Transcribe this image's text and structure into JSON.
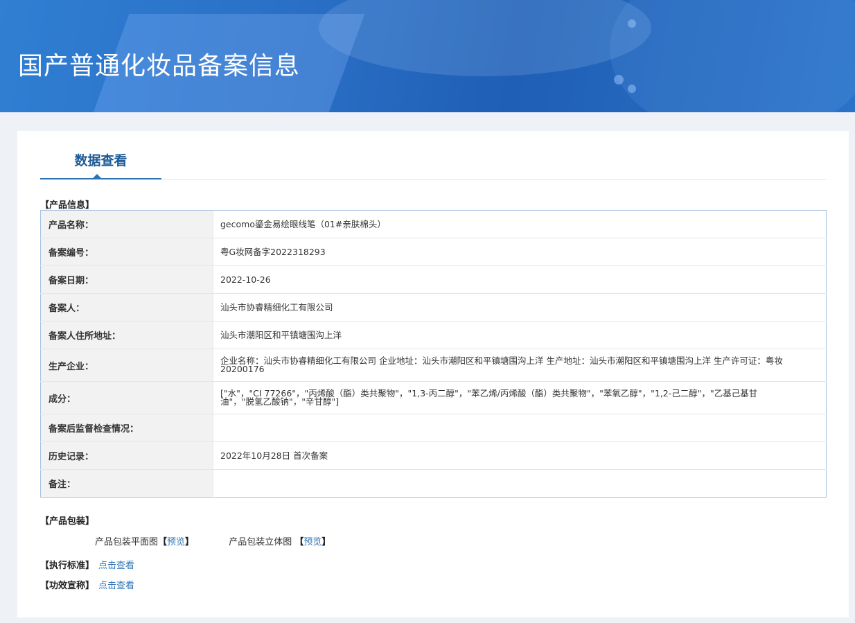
{
  "banner": {
    "title": "国产普通化妆品备案信息"
  },
  "tab": {
    "label": "数据查看"
  },
  "product_info": {
    "heading": "【产品信息】",
    "rows": [
      {
        "label": "产品名称：",
        "value": "gecomo鎏金易绘眼线笔（01#亲肤棉头）"
      },
      {
        "label": "备案编号：",
        "value": "粤G妆网备字2022318293"
      },
      {
        "label": "备案日期：",
        "value": "2022-10-26"
      },
      {
        "label": "备案人：",
        "value": "汕头市协睿精细化工有限公司"
      },
      {
        "label": "备案人住所地址：",
        "value": "汕头市潮阳区和平镇塘围沟上洋"
      },
      {
        "label": "生产企业：",
        "value": "企业名称：汕头市协睿精细化工有限公司 企业地址：汕头市潮阳区和平镇塘围沟上洋 生产地址：汕头市潮阳区和平镇塘围沟上洋 生产许可证：粤妆20200176"
      },
      {
        "label": "成分：",
        "value": "[\"水\"，\"CI 77266\"，\"丙烯酸（酯）类共聚物\"，\"1,3-丙二醇\"，\"苯乙烯/丙烯酸（酯）类共聚物\"，\"苯氧乙醇\"，\"1,2-己二醇\"，\"乙基己基甘油\"，\"脱氢乙酸钠\"，\"辛甘醇\"]"
      },
      {
        "label": "备案后监督检查情况：",
        "value": ""
      },
      {
        "label": "历史记录：",
        "value": "2022年10月28日 首次备案"
      },
      {
        "label": "备注：",
        "value": ""
      }
    ]
  },
  "packaging": {
    "heading": "【产品包装】",
    "flat_label": "产品包装平面图",
    "flat_link": "预览",
    "stereo_label": "产品包装立体图",
    "stereo_link": "预览",
    "bracket_open": "【",
    "bracket_close": "】"
  },
  "standard": {
    "label": "【执行标准】",
    "link": "点击查看"
  },
  "efficacy": {
    "label": "【功效宣称】",
    "link": "点击查看"
  }
}
